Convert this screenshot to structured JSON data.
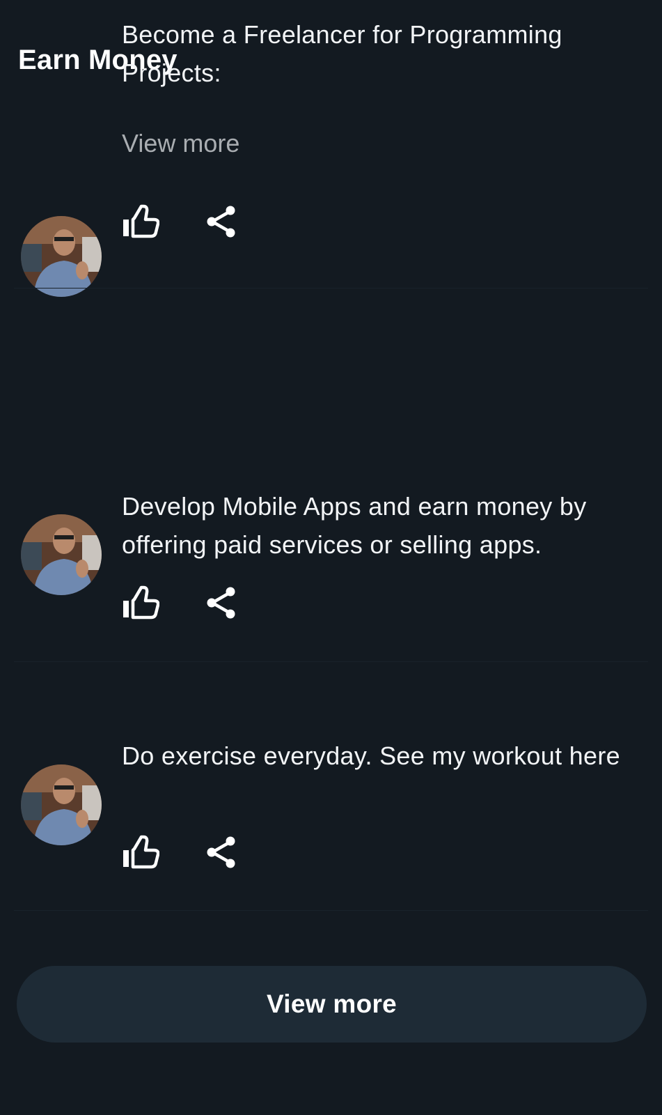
{
  "header": {
    "title": "Earn Money"
  },
  "posts": [
    {
      "text": "Become a Freelancer for Programming Projects:",
      "view_more": "View more",
      "like_icon": "thumbs-up-icon",
      "share_icon": "share-icon"
    },
    {
      "text": "Develop Mobile Apps and earn money by offering paid services or selling apps.",
      "like_icon": "thumbs-up-icon",
      "share_icon": "share-icon"
    },
    {
      "text": "Do exercise everyday. See my workout here",
      "like_icon": "thumbs-up-icon",
      "share_icon": "share-icon"
    }
  ],
  "footer": {
    "view_more_label": "View more"
  },
  "colors": {
    "background": "#131a21",
    "button_bg": "#1e2b36",
    "muted_text": "#a9adb1",
    "text": "#ffffff"
  }
}
